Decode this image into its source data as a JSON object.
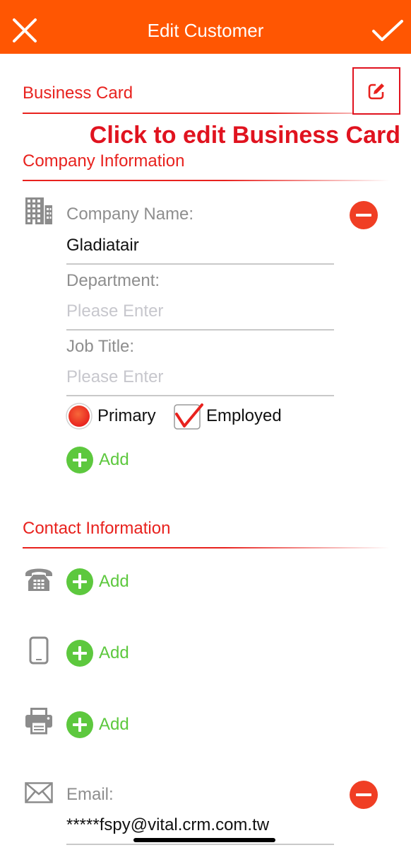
{
  "colors": {
    "header_background": "#FF5602",
    "accent_red": "#E8221E",
    "annotation_red": "#E0131F",
    "add_green": "#5DC83E",
    "remove_red": "#F03E24",
    "icon_gray": "#8C8C8C"
  },
  "header": {
    "title": "Edit Customer",
    "close_icon": "close-icon",
    "confirm_icon": "checkmark-icon"
  },
  "business_card": {
    "title": "Business Card",
    "edit_icon": "edit-icon",
    "annotation": "Click to edit Business Card"
  },
  "company": {
    "title": "Company Information",
    "icon": "building-icon",
    "remove_icon": "minus-circle-icon",
    "fields": [
      {
        "label": "Company Name:",
        "value": "Gladiatair"
      },
      {
        "label": "Department:",
        "value": "",
        "placeholder": "Please Enter"
      },
      {
        "label": "Job Title:",
        "value": "",
        "placeholder": "Please Enter"
      }
    ],
    "primary": {
      "label": "Primary",
      "selected": true
    },
    "employed": {
      "label": "Employed",
      "checked": true
    },
    "add": {
      "label": "Add",
      "icon": "plus-circle-icon"
    }
  },
  "contact": {
    "title": "Contact Information",
    "rows": [
      {
        "icon": "telephone-icon",
        "add_label": "Add"
      },
      {
        "icon": "mobile-phone-icon",
        "add_label": "Add"
      },
      {
        "icon": "fax-icon",
        "add_label": "Add"
      }
    ],
    "email": {
      "icon": "mail-icon",
      "label": "Email:",
      "value": "*****fspy@vital.crm.com.tw",
      "remove_icon": "minus-circle-icon"
    }
  }
}
